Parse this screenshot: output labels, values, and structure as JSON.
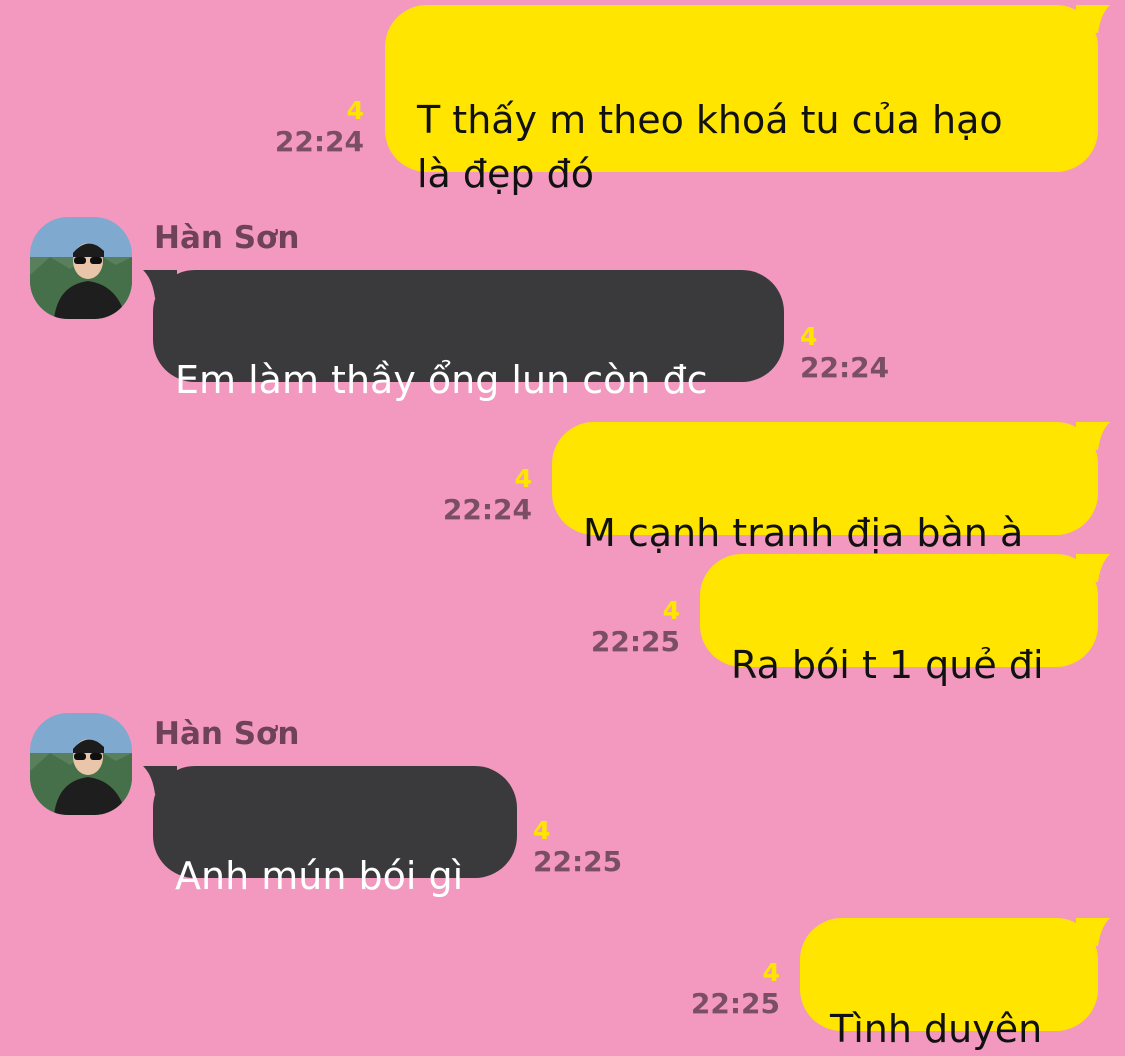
{
  "colors": {
    "background": "#f399c0",
    "outgoing_bubble": "#ffe500",
    "incoming_bubble": "#3a3a3c",
    "unread_count": "#ffe500",
    "timestamp": "#7a4e63",
    "sender_name": "#6e4258"
  },
  "messages": [
    {
      "direction": "outgoing",
      "text": "T thấy m theo khoá tu của hạo\nlà đẹp đó",
      "unread": "4",
      "time": "22:24"
    },
    {
      "direction": "incoming",
      "sender": "Hàn Sơn",
      "avatar_icon": "profile-photo",
      "text": "Em làm thầy ổng lun còn đc",
      "unread": "4",
      "time": "22:24"
    },
    {
      "direction": "outgoing",
      "text": "M cạnh tranh địa bàn à",
      "unread": "4",
      "time": "22:24"
    },
    {
      "direction": "outgoing",
      "text": "Ra bói t 1 quẻ đi",
      "unread": "4",
      "time": "22:25"
    },
    {
      "direction": "incoming",
      "sender": "Hàn Sơn",
      "avatar_icon": "profile-photo",
      "text": "Anh mún bói gì",
      "unread": "4",
      "time": "22:25"
    },
    {
      "direction": "outgoing",
      "text": "Tình duyên",
      "unread": "4",
      "time": "22:25"
    }
  ]
}
